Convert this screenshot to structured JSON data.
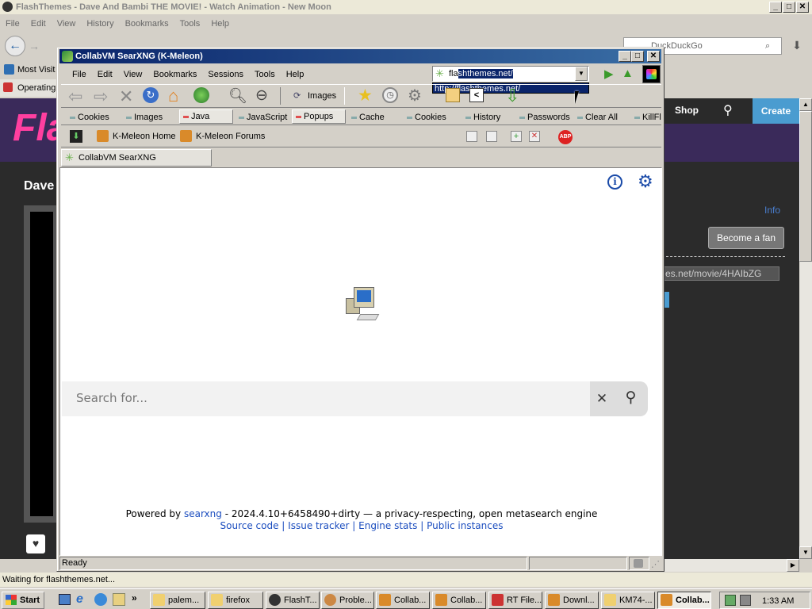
{
  "back_window": {
    "title": "FlashThemes - Dave And Bambi THE MOVIE! - Watch Animation - New Moon",
    "menu": [
      "File",
      "Edit",
      "View",
      "History",
      "Bookmarks",
      "Tools",
      "Help"
    ],
    "search_placeholder": "DuckDuckGo",
    "bookmark_most": "Most Visit",
    "tab_label": "Operating",
    "site_nav": {
      "shop": "Shop",
      "create": "Create"
    },
    "heading": "Dave",
    "info_link": "Info",
    "fan_button": "Become a fan",
    "share_url": "es.net/movie/4HAIbZG",
    "status": "Waiting for flashthemes.net..."
  },
  "kmeleon": {
    "title": "CollabVM SearXNG (K-Meleon)",
    "menu": [
      "File",
      "Edit",
      "View",
      "Bookmarks",
      "Sessions",
      "Tools",
      "Help"
    ],
    "url_value_typed": "fla",
    "url_value_selected": "shthemes.net/",
    "url_suggestion": "http://flashthemes.net/",
    "images_button": "Images",
    "privacy_left": [
      "Cookies",
      "Images",
      "Java",
      "JavaScript",
      "Popups"
    ],
    "privacy_right": [
      "Cache",
      "Cookies",
      "History",
      "Passwords",
      "Clear All",
      "KillFla"
    ],
    "bookmarks": [
      "K-Meleon Home",
      "K-Meleon Forums"
    ],
    "tab": "CollabVM SearXNG",
    "status": "Ready"
  },
  "searx": {
    "search_placeholder": "Search for...",
    "footer_powered": "Powered by",
    "footer_brand": "searxng",
    "footer_rest": "- 2024.4.10+6458490+dirty — a privacy-respecting, open metasearch engine",
    "footer_links": [
      "Source code",
      "Issue tracker",
      "Engine stats",
      "Public instances"
    ],
    "footer_sep": "|"
  },
  "taskbar": {
    "start": "Start",
    "quick_chevron": "»",
    "items": [
      "palem...",
      "firefox",
      "FlashT...",
      "Proble...",
      "Collab...",
      "Collab...",
      "RT File...",
      "Downl...",
      "KM74-...",
      "Collab..."
    ],
    "clock": "1:33 AM"
  }
}
